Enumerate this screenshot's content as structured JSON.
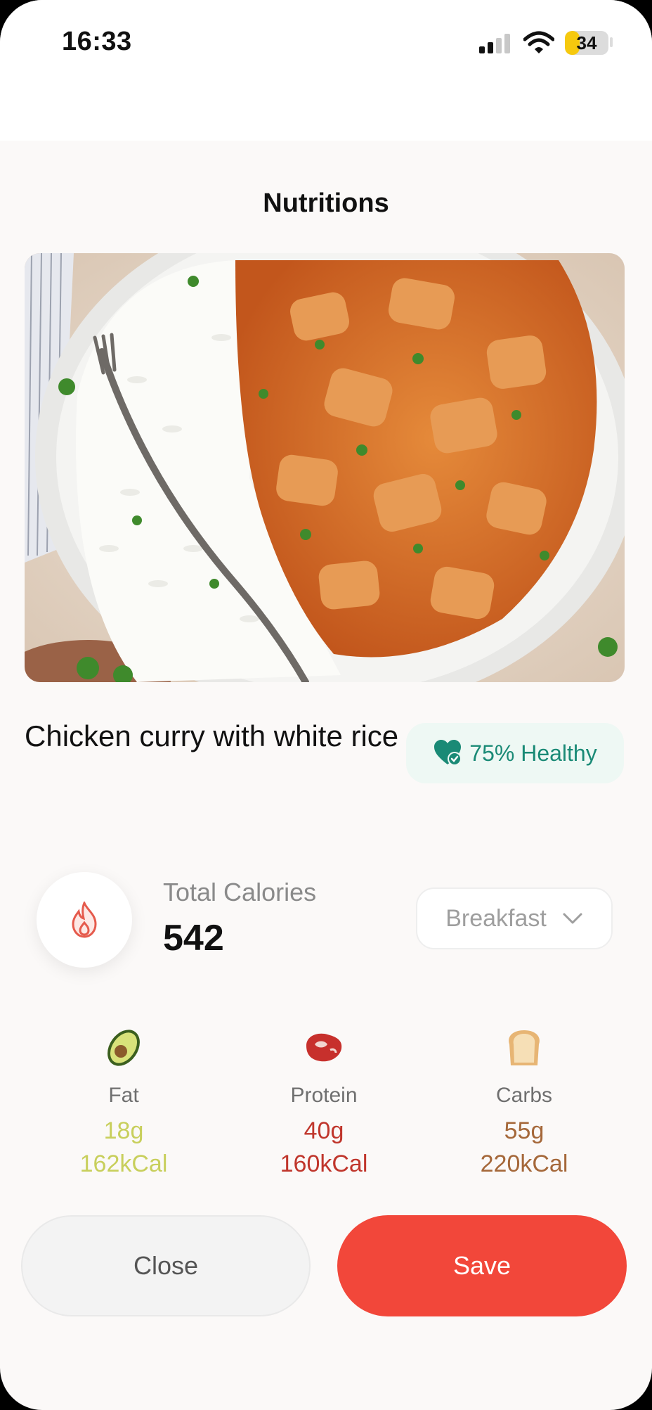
{
  "status_bar": {
    "time": "16:33",
    "battery": "34",
    "battery_level": 0.34
  },
  "page": {
    "title": "Nutritions"
  },
  "food": {
    "name": "Chicken curry with white rice",
    "health_badge": "75% Healthy",
    "health_score": 75
  },
  "calories": {
    "label": "Total Calories",
    "value": "542"
  },
  "meal_select": {
    "value": "Breakfast"
  },
  "macros": [
    {
      "name": "Fat",
      "grams": "18g",
      "kcal": "162kCal",
      "color": "#c8cf5c",
      "icon": "avocado-icon"
    },
    {
      "name": "Protein",
      "grams": "40g",
      "kcal": "160kCal",
      "color": "#c0362c",
      "icon": "steak-icon"
    },
    {
      "name": "Carbs",
      "grams": "55g",
      "kcal": "220kCal",
      "color": "#a5683a",
      "icon": "bread-icon"
    }
  ],
  "buttons": {
    "close": "Close",
    "save": "Save"
  },
  "colors": {
    "accent": "#f2473a",
    "healthy": "#1a8a76"
  }
}
